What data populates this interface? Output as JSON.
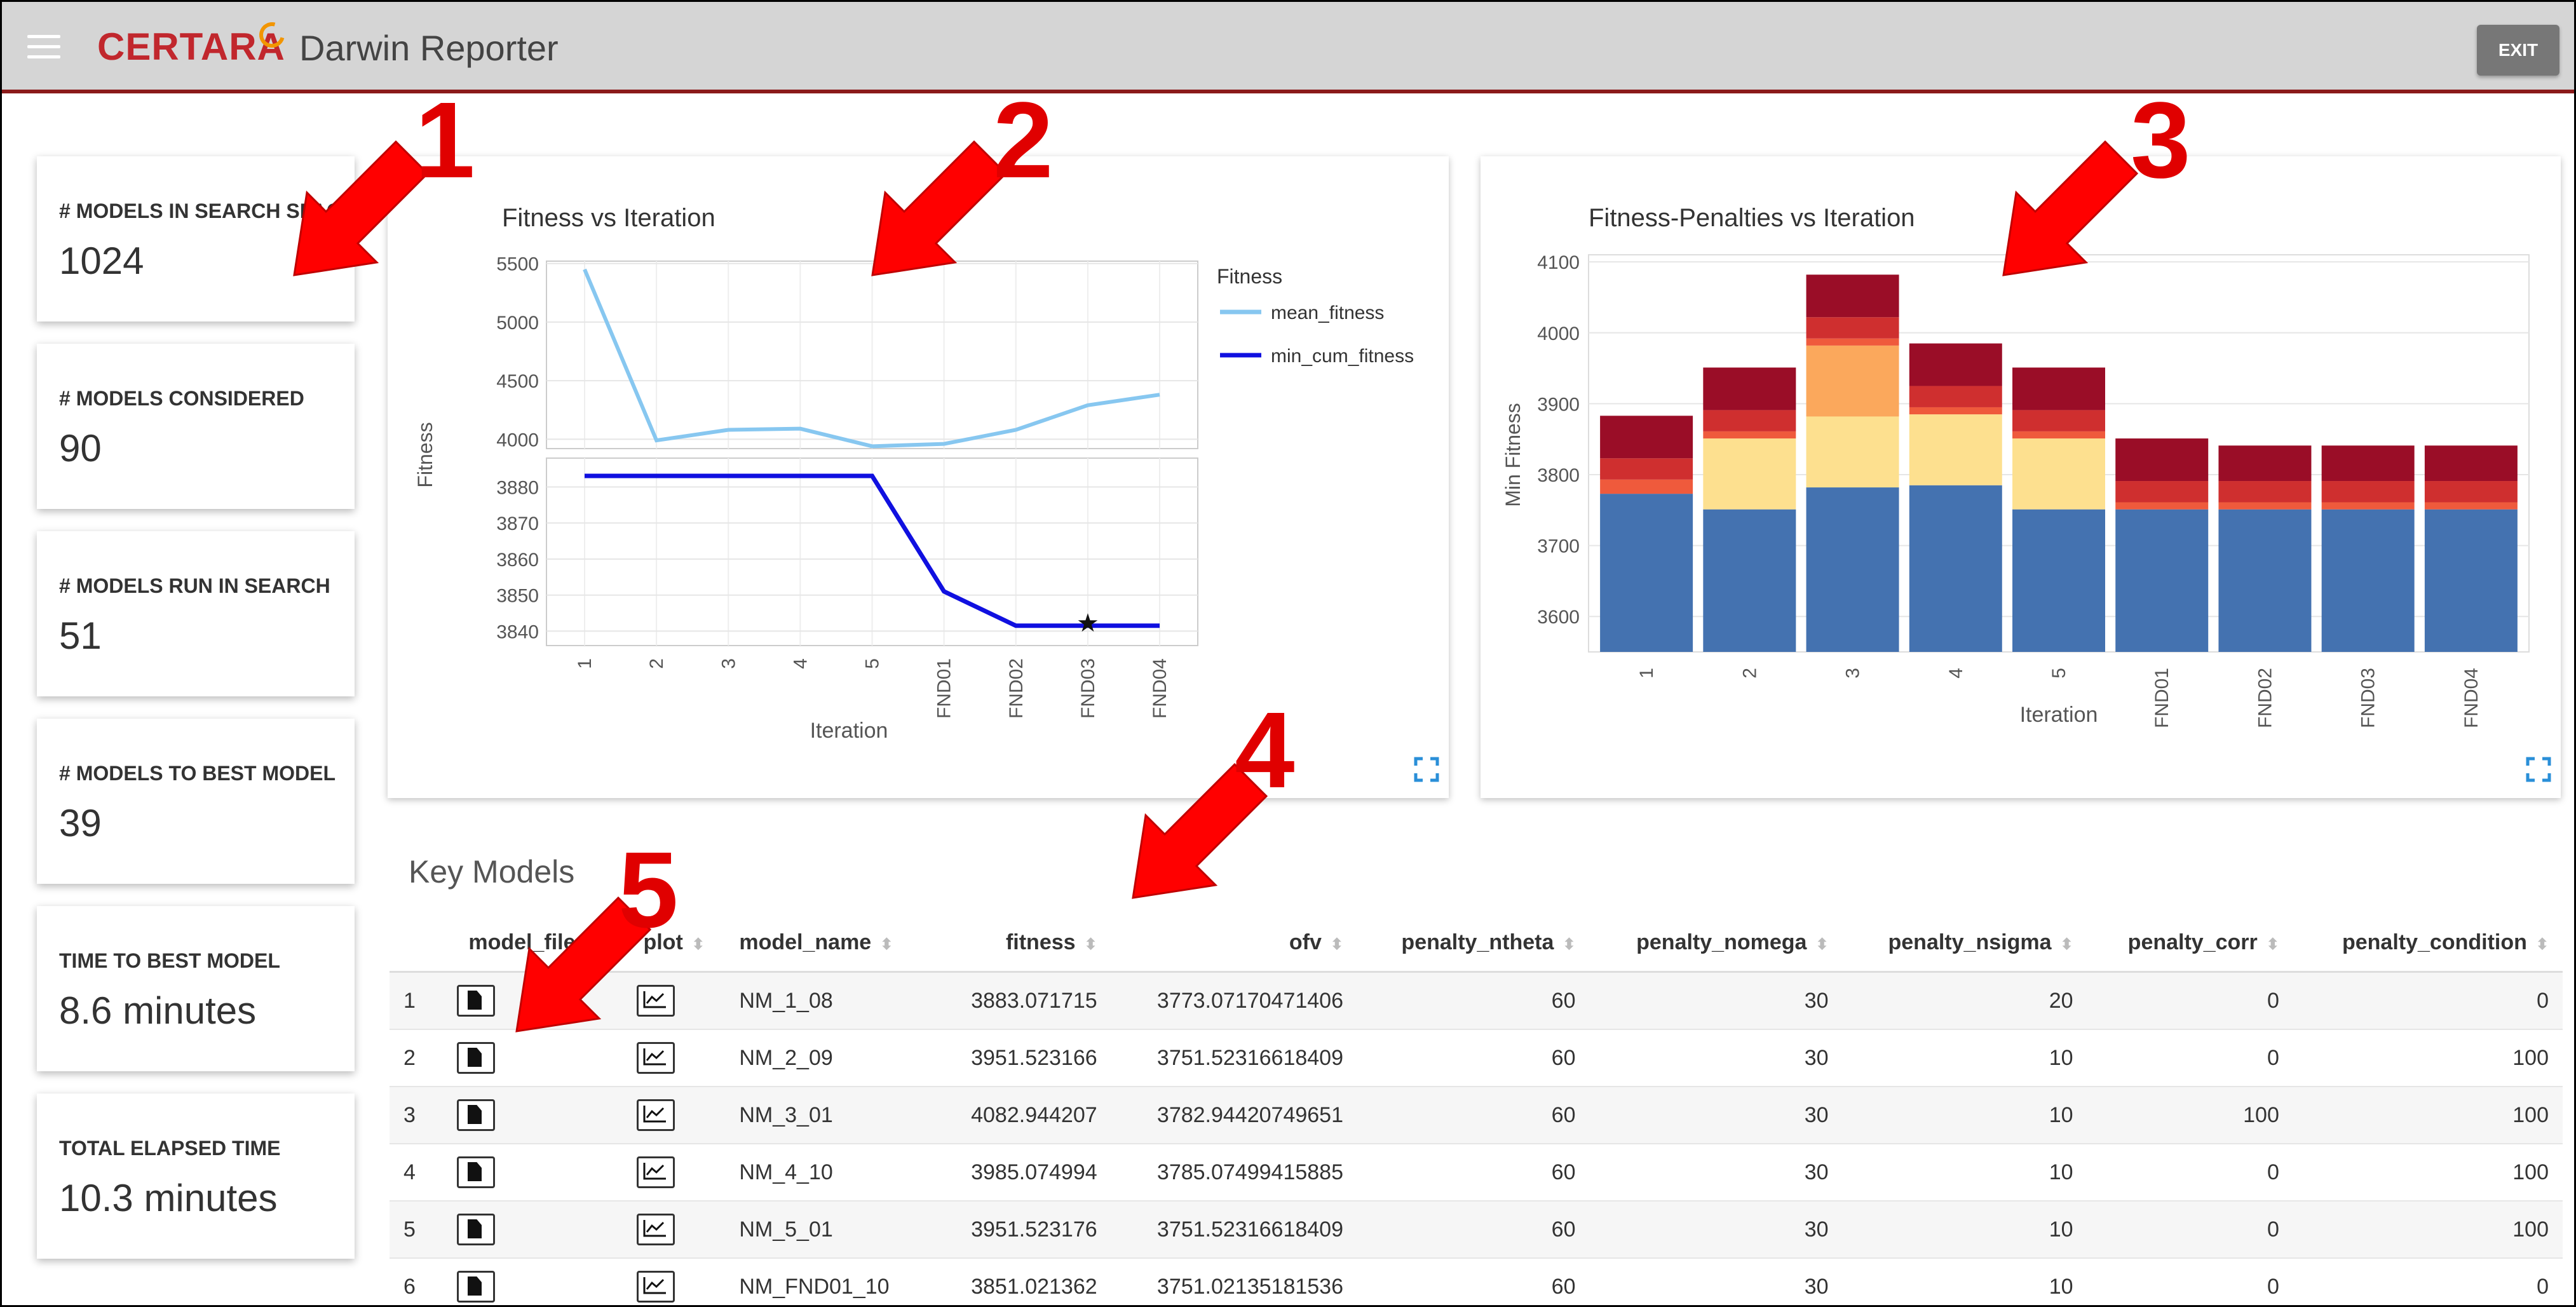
{
  "header": {
    "logo": "CERTARA",
    "title": "Darwin Reporter",
    "exit_label": "EXIT"
  },
  "cards": [
    {
      "label": "# MODELS IN SEARCH SPACE",
      "value": "1024"
    },
    {
      "label": "# MODELS CONSIDERED",
      "value": "90"
    },
    {
      "label": "# MODELS RUN IN SEARCH",
      "value": "51"
    },
    {
      "label": "# MODELS TO BEST MODEL",
      "value": "39"
    },
    {
      "label": "TIME TO BEST MODEL",
      "value": "8.6 minutes"
    },
    {
      "label": "TOTAL ELAPSED TIME",
      "value": "10.3 minutes"
    }
  ],
  "annotations": [
    "1",
    "2",
    "3",
    "4",
    "5"
  ],
  "chart_data": [
    {
      "type": "line",
      "title": "Fitness vs Iteration",
      "xlabel": "Iteration",
      "ylabel": "Fitness",
      "categories": [
        "1",
        "2",
        "3",
        "4",
        "5",
        "FND01",
        "FND02",
        "FND03",
        "FND04"
      ],
      "legend_title": "Fitness",
      "legend_position": "right",
      "series": [
        {
          "name": "mean_fitness",
          "color": "#87c7f0",
          "values": [
            5450,
            3990,
            4080,
            4090,
            3940,
            3960,
            4080,
            4290,
            4380
          ],
          "yticks": [
            4000,
            4500,
            5000,
            5500
          ]
        },
        {
          "name": "min_cum_fitness",
          "color": "#1010e0",
          "values": [
            3883.07,
            3883.07,
            3883.07,
            3883.07,
            3883.07,
            3851.02,
            3841.5,
            3841.5,
            3841.5
          ],
          "yticks": [
            3840,
            3850,
            3860,
            3870,
            3880
          ]
        }
      ],
      "marker": {
        "category": "FND03",
        "value": 3842,
        "symbol": "star"
      }
    },
    {
      "type": "bar",
      "stacked": true,
      "title": "Fitness-Penalties vs Iteration",
      "xlabel": "Iteration",
      "ylabel": "Min Fitness",
      "ylim": [
        3550,
        4110
      ],
      "yticks": [
        3600,
        3700,
        3800,
        3900,
        4000,
        4100
      ],
      "categories": [
        "1",
        "2",
        "3",
        "4",
        "5",
        "FND01",
        "FND02",
        "FND03",
        "FND04"
      ],
      "series": [
        {
          "color": "#4472b0",
          "values": [
            3773,
            3751,
            3782,
            3785,
            3751,
            3751,
            3751,
            3751,
            3751
          ]
        },
        {
          "color": "#fde08f",
          "values": [
            0,
            100,
            100,
            100,
            100,
            0,
            0,
            0,
            0
          ]
        },
        {
          "color": "#fba85c",
          "values": [
            0,
            0,
            100,
            0,
            0,
            0,
            0,
            0,
            0
          ]
        },
        {
          "color": "#ef5a3c",
          "values": [
            20,
            10,
            10,
            10,
            10,
            10,
            10,
            10,
            10
          ]
        },
        {
          "color": "#cf2f2f",
          "values": [
            30,
            30,
            30,
            30,
            30,
            30,
            30,
            30,
            30
          ]
        },
        {
          "color": "#9a0d27",
          "values": [
            60,
            60,
            60,
            60,
            60,
            60,
            50,
            50,
            50
          ]
        }
      ]
    }
  ],
  "table": {
    "title": "Key Models",
    "columns": [
      "model_file",
      "plot",
      "model_name",
      "fitness",
      "ofv",
      "penalty_ntheta",
      "penalty_nomega",
      "penalty_nsigma",
      "penalty_corr",
      "penalty_condition"
    ],
    "rows": [
      {
        "idx": "1",
        "model_name": "NM_1_08",
        "fitness": "3883.071715",
        "ofv": "3773.07170471406",
        "penalty_ntheta": "60",
        "penalty_nomega": "30",
        "penalty_nsigma": "20",
        "penalty_corr": "0",
        "penalty_condition": "0"
      },
      {
        "idx": "2",
        "model_name": "NM_2_09",
        "fitness": "3951.523166",
        "ofv": "3751.52316618409",
        "penalty_ntheta": "60",
        "penalty_nomega": "30",
        "penalty_nsigma": "10",
        "penalty_corr": "0",
        "penalty_condition": "100"
      },
      {
        "idx": "3",
        "model_name": "NM_3_01",
        "fitness": "4082.944207",
        "ofv": "3782.94420749651",
        "penalty_ntheta": "60",
        "penalty_nomega": "30",
        "penalty_nsigma": "10",
        "penalty_corr": "100",
        "penalty_condition": "100"
      },
      {
        "idx": "4",
        "model_name": "NM_4_10",
        "fitness": "3985.074994",
        "ofv": "3785.07499415885",
        "penalty_ntheta": "60",
        "penalty_nomega": "30",
        "penalty_nsigma": "10",
        "penalty_corr": "0",
        "penalty_condition": "100"
      },
      {
        "idx": "5",
        "model_name": "NM_5_01",
        "fitness": "3951.523176",
        "ofv": "3751.52316618409",
        "penalty_ntheta": "60",
        "penalty_nomega": "30",
        "penalty_nsigma": "10",
        "penalty_corr": "0",
        "penalty_condition": "100"
      },
      {
        "idx": "6",
        "model_name": "NM_FND01_10",
        "fitness": "3851.021362",
        "ofv": "3751.02135181536",
        "penalty_ntheta": "60",
        "penalty_nomega": "30",
        "penalty_nsigma": "10",
        "penalty_corr": "0",
        "penalty_condition": "0"
      }
    ]
  }
}
